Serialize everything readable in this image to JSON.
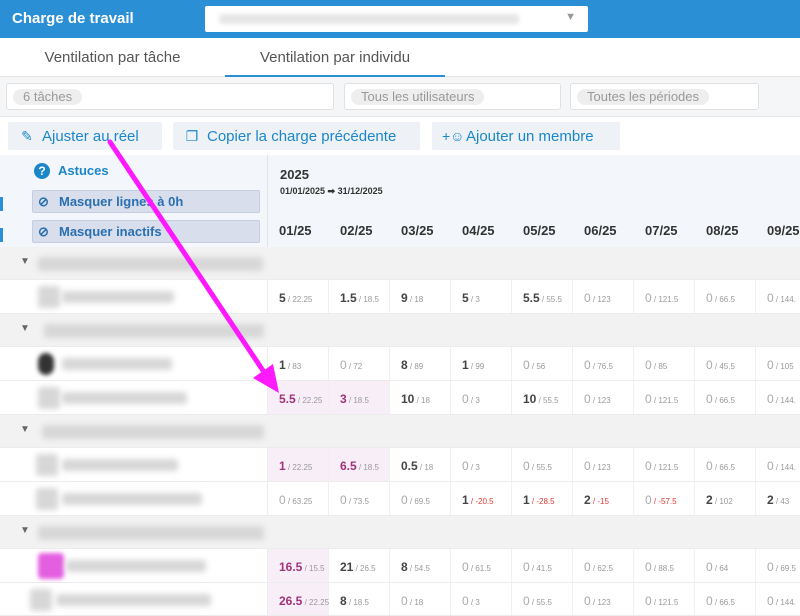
{
  "topbar": {
    "title": "Charge de travail"
  },
  "tabs": [
    {
      "label": "Ventilation par tâche"
    },
    {
      "label": "Ventilation par individu"
    }
  ],
  "filters": {
    "tasks": "6 tâches",
    "users": "Tous les utilisateurs",
    "periods": "Toutes les périodes"
  },
  "actions": {
    "adjust": "Ajuster au réel",
    "copy": "Copier la charge précédente",
    "add_member": "Ajouter un membre"
  },
  "left_header": {
    "hints": "Astuces",
    "hide_zero": "Masquer lignes à 0h",
    "hide_inactive": "Masquer inactifs"
  },
  "period": {
    "year": "2025",
    "range": "01/01/2025 ➡ 31/12/2025"
  },
  "months": [
    "01/25",
    "02/25",
    "03/25",
    "04/25",
    "05/25",
    "06/25",
    "07/25",
    "08/25",
    "09/25"
  ],
  "rows": {
    "r1": [
      [
        "5",
        "/ 22.25"
      ],
      [
        "1.5",
        "/ 18.5"
      ],
      [
        "9",
        "/ 18"
      ],
      [
        "5",
        "/ 3"
      ],
      [
        "5.5",
        "/ 55.5"
      ],
      [
        "0",
        "/ 123"
      ],
      [
        "0",
        "/ 121.5"
      ],
      [
        "0",
        "/ 66.5"
      ],
      [
        "0",
        "/ 144."
      ]
    ],
    "r2": [
      [
        "1",
        "/ 83"
      ],
      [
        "0",
        "/ 72"
      ],
      [
        "8",
        "/ 89"
      ],
      [
        "1",
        "/ 99"
      ],
      [
        "0",
        "/ 56"
      ],
      [
        "0",
        "/ 76.5"
      ],
      [
        "0",
        "/ 85"
      ],
      [
        "0",
        "/ 45.5"
      ],
      [
        "0",
        "/ 105"
      ]
    ],
    "r3": [
      [
        "5.5",
        "/ 22.25"
      ],
      [
        "3",
        "/ 18.5"
      ],
      [
        "10",
        "/ 18"
      ],
      [
        "0",
        "/ 3"
      ],
      [
        "10",
        "/ 55.5"
      ],
      [
        "0",
        "/ 123"
      ],
      [
        "0",
        "/ 121.5"
      ],
      [
        "0",
        "/ 66.5"
      ],
      [
        "0",
        "/ 144."
      ]
    ],
    "r4": [
      [
        "1",
        "/ 22.25"
      ],
      [
        "6.5",
        "/ 18.5"
      ],
      [
        "0.5",
        "/ 18"
      ],
      [
        "0",
        "/ 3"
      ],
      [
        "0",
        "/ 55.5"
      ],
      [
        "0",
        "/ 123"
      ],
      [
        "0",
        "/ 121.5"
      ],
      [
        "0",
        "/ 66.5"
      ],
      [
        "0",
        "/ 144."
      ]
    ],
    "r5": [
      [
        "0",
        "/ 63.25"
      ],
      [
        "0",
        "/ 73.5"
      ],
      [
        "0",
        "/ 69.5"
      ],
      [
        "1",
        "/ -20.5"
      ],
      [
        "1",
        "/ -28.5"
      ],
      [
        "2",
        "/ -15"
      ],
      [
        "0",
        "/ -57.5"
      ],
      [
        "2",
        "/ 102"
      ],
      [
        "2",
        "/ 43"
      ]
    ],
    "r6": [
      [
        "16.5",
        "/ 15.5"
      ],
      [
        "21",
        "/ 26.5"
      ],
      [
        "8",
        "/ 54.5"
      ],
      [
        "0",
        "/ 61.5"
      ],
      [
        "0",
        "/ 41.5"
      ],
      [
        "0",
        "/ 62.5"
      ],
      [
        "0",
        "/ 88.5"
      ],
      [
        "0",
        "/ 64"
      ],
      [
        "0",
        "/ 69.5"
      ]
    ],
    "r7": [
      [
        "26.5",
        "/ 22.25"
      ],
      [
        "8",
        "/ 18.5"
      ],
      [
        "0",
        "/ 18"
      ],
      [
        "0",
        "/ 3"
      ],
      [
        "0",
        "/ 55.5"
      ],
      [
        "0",
        "/ 123"
      ],
      [
        "0",
        "/ 121.5"
      ],
      [
        "0",
        "/ 66.5"
      ],
      [
        "0",
        "/ 144."
      ]
    ]
  },
  "colors": {
    "accent": "#2b8fd6",
    "highlight": "#a0337a",
    "negative": "#e53935",
    "arrow": "#ff19ff"
  }
}
